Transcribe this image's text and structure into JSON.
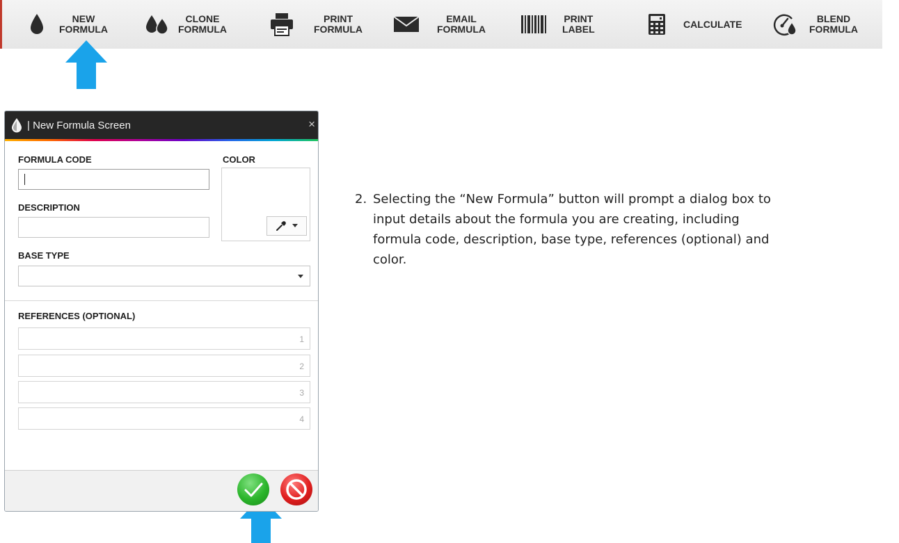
{
  "toolbar": {
    "accent_color": "#c0392b",
    "buttons": [
      {
        "line1": "NEW",
        "line2": "FORMULA",
        "icon": "drop-icon"
      },
      {
        "line1": "CLONE",
        "line2": "FORMULA",
        "icon": "double-drop-icon"
      },
      {
        "line1": "PRINT",
        "line2": "FORMULA",
        "icon": "printer-icon"
      },
      {
        "line1": "EMAIL",
        "line2": "FORMULA",
        "icon": "envelope-icon"
      },
      {
        "line1": "PRINT",
        "line2": "LABEL",
        "icon": "barcode-icon"
      },
      {
        "line1": "CALCULATE",
        "line2": "",
        "icon": "calculator-icon"
      },
      {
        "line1": "BLEND",
        "line2": "FORMULA",
        "icon": "gauge-drop-icon"
      }
    ]
  },
  "dialog": {
    "title": "| New Formula Screen",
    "close_glyph": "×",
    "formula_code": {
      "label": "FORMULA CODE",
      "value": ""
    },
    "description": {
      "label": "DESCRIPTION",
      "value": ""
    },
    "color": {
      "label": "COLOR"
    },
    "base_type": {
      "label": "BASE TYPE",
      "value": ""
    },
    "references": {
      "label": "REFERENCES (OPTIONAL)",
      "items": [
        {
          "num": "1",
          "value": ""
        },
        {
          "num": "2",
          "value": ""
        },
        {
          "num": "3",
          "value": ""
        },
        {
          "num": "4",
          "value": ""
        }
      ]
    }
  },
  "instruction": {
    "number": "2.",
    "text": "Selecting the “New Formula” button will prompt a dialog box to input details about the formula you are creating, including formula code, description, base type, references (optional) and color."
  },
  "colors": {
    "arrow": "#1aa3ea",
    "ok": "#2bb52b",
    "cancel": "#e01e1e"
  }
}
